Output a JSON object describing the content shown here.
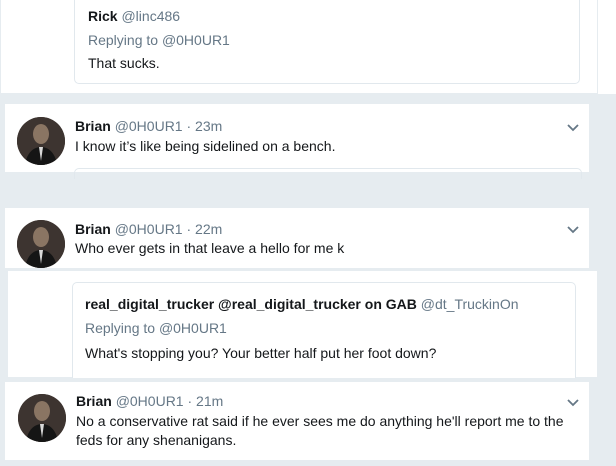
{
  "top_quote": {
    "name": "Rick",
    "handle": "@linc486",
    "replying_prefix": "Replying to",
    "replying_to": "@0H0UR1",
    "text": "That sucks."
  },
  "tweet1": {
    "name": "Brian",
    "handle": "@0H0UR1",
    "time": "· 23m",
    "text": "I know it’s like being sidelined on a bench."
  },
  "tweet2": {
    "name": "Brian",
    "handle": "@0H0UR1",
    "time": "· 22m",
    "text": "Who ever gets in that leave a hello for me k"
  },
  "mid_quote": {
    "name": "real_digital_trucker @real_digital_trucker on GAB",
    "handle": "@dt_TruckinOn",
    "replying_prefix": "Replying to",
    "replying_to": "@0H0UR1",
    "text": "What's stopping you?  Your better half put her foot down?"
  },
  "tweet3": {
    "name": "Brian",
    "handle": "@0H0UR1",
    "time": "· 21m",
    "text": "No a conservative rat said if he ever sees me do anything he'll report me to the feds for any shenanigans."
  },
  "icons": {
    "avatar": "profile-photo",
    "caret": "chevron-down-icon"
  },
  "colors": {
    "secondary_text": "#657786",
    "border": "#e1e8ed",
    "background": "#e6ecf0"
  }
}
